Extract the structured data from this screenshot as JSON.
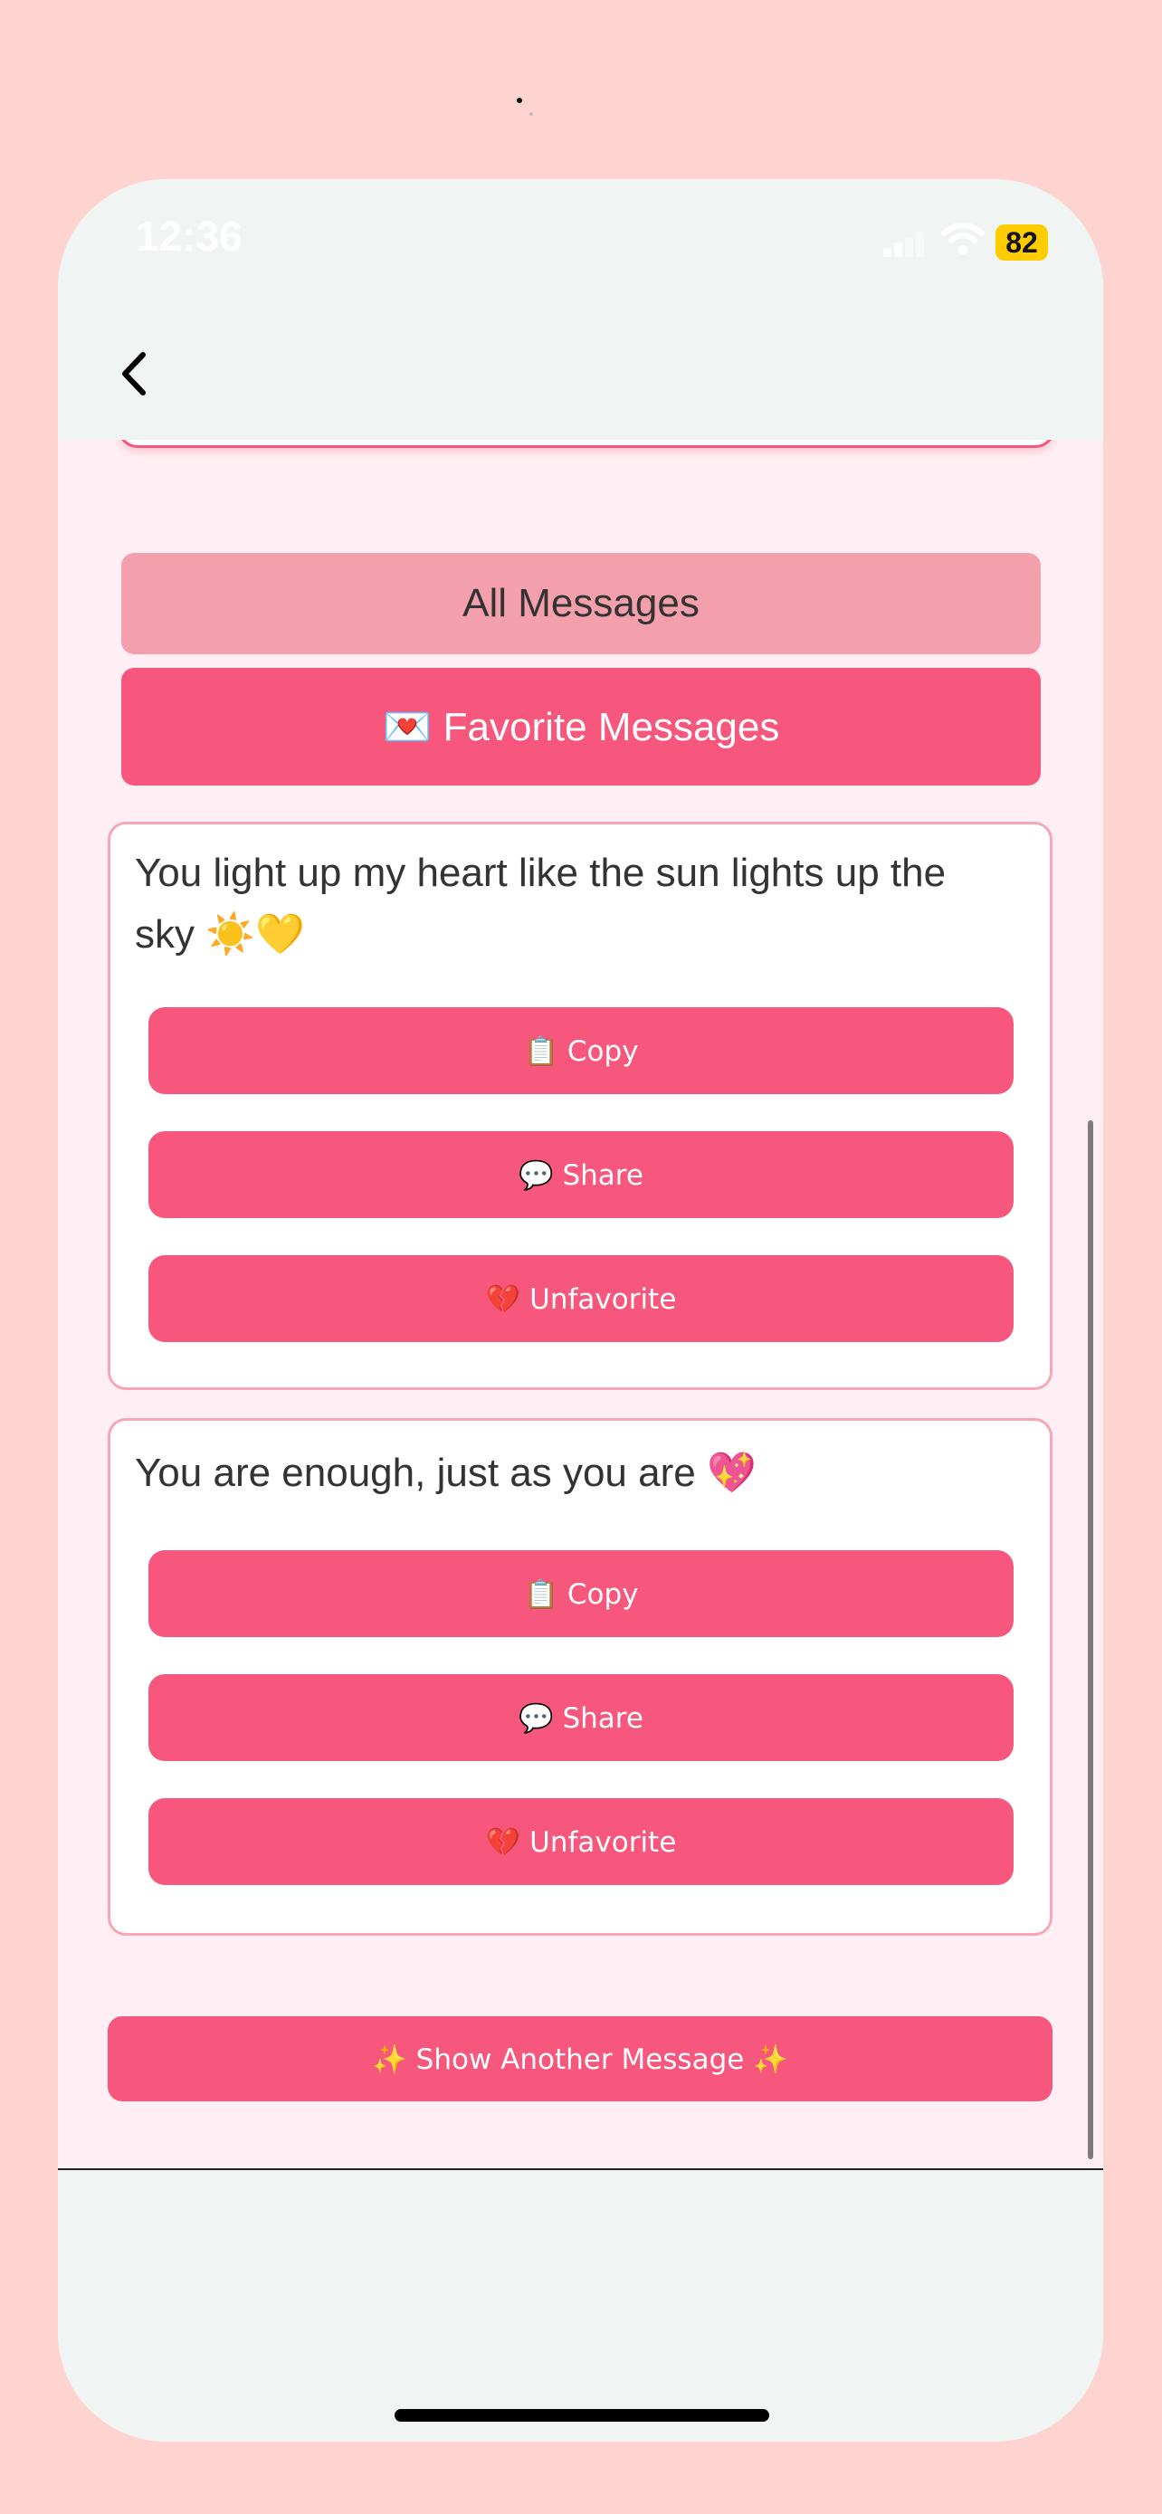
{
  "status_bar": {
    "time": "12:36",
    "battery": "82"
  },
  "tabs": {
    "all_label": "All Messages",
    "favorite_label": "💌 Favorite Messages"
  },
  "messages": [
    {
      "text": "You light up my heart like the sun lights up the sky ☀️💛",
      "copy_label": "📋 Copy",
      "share_label": "💬 Share",
      "unfavorite_label": "💔 Unfavorite"
    },
    {
      "text": "You are enough, just as you are 💖",
      "copy_label": "📋 Copy",
      "share_label": "💬 Share",
      "unfavorite_label": "💔 Unfavorite"
    }
  ],
  "show_another_label": "✨ Show Another Message ✨",
  "icons": {
    "back": "chevron-left-icon",
    "wifi": "wifi-icon",
    "signal": "cellular-signal-icon",
    "battery": "battery-icon"
  },
  "colors": {
    "page_background": "#ffd4d0",
    "content_background": "#ffeef3",
    "accent": "#f7567d",
    "tab_inactive": "#f4a0ac",
    "card_border": "#f8a6b6",
    "battery": "#ffcc00"
  }
}
